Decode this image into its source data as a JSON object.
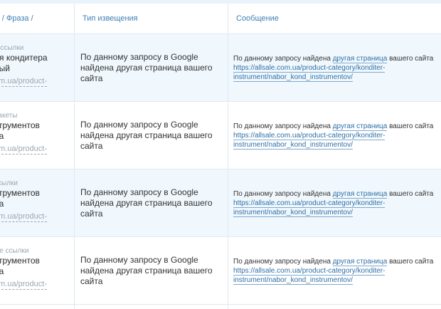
{
  "table": {
    "headers": {
      "col1_line1": "ь / Фраза /",
      "col1_line2": "",
      "col2": "Тип извещения",
      "col3": "Сообщение"
    },
    "rows": [
      {
        "type": "е ссылки",
        "phrase1": "ля кондитера",
        "phrase2": "ный",
        "url": "om.ua/product-",
        "notice": "По данному запросу в Google найдена другая страница вашего сайта",
        "msg_prefix": "По данному запросу найдена",
        "msg_link": "другая страница",
        "msg_suffix": "вашего сайта",
        "msg_url": "https://allsale.com.ua/product-category/konditer-instrument/nabor_kond_instrumentov/"
      },
      {
        "type": "пакеты",
        "phrase1": "струментов",
        "phrase2": "ра",
        "url": "om.ua/product-",
        "notice": "По данному запросу в Google найдена другая страница вашего сайта",
        "msg_prefix": "По данному запросу найдена",
        "msg_link": "другая страница",
        "msg_suffix": "вашего сайта",
        "msg_url": "https://allsale.com.ua/product-category/konditer-instrument/nabor_kond_instrumentov/"
      },
      {
        "type": "ссылки",
        "phrase1": "струментов",
        "phrase2": "ра",
        "url": "om.ua/product-",
        "notice": "По данному запросу в Google найдена другая страница вашего сайта",
        "msg_prefix": "По данному запросу найдена",
        "msg_link": "другая страница",
        "msg_suffix": "вашего сайта",
        "msg_url": "https://allsale.com.ua/product-category/konditer-instrument/nabor_kond_instrumentov/"
      },
      {
        "type": "ые ссылки",
        "phrase1": "струментов",
        "phrase2": "ра",
        "url": "om.ua/product-",
        "notice": "По данному запросу в Google найдена другая страница вашего сайта",
        "msg_prefix": "По данному запросу найдена",
        "msg_link": "другая страница",
        "msg_suffix": "вашего сайта",
        "msg_url": "https://allsale.com.ua/product-category/konditer-instrument/nabor_kond_instrumentov/"
      }
    ]
  }
}
